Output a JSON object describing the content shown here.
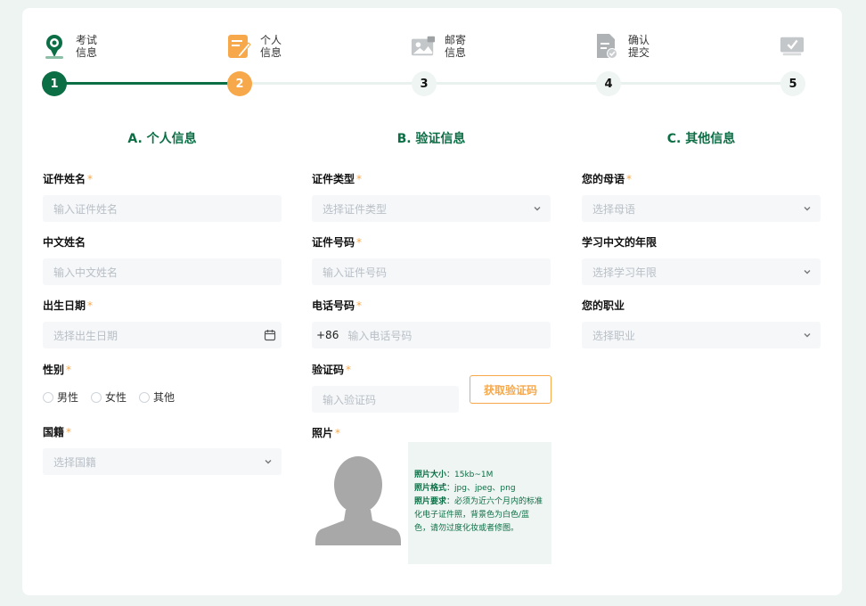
{
  "steps": [
    {
      "label1": "考试",
      "label2": "信息",
      "number": "1",
      "state": "done",
      "icon": "location-pin-icon"
    },
    {
      "label1": "个人",
      "label2": "信息",
      "number": "2",
      "state": "active",
      "icon": "edit-note-icon"
    },
    {
      "label1": "邮寄",
      "label2": "信息",
      "number": "3",
      "state": "todo",
      "icon": "image-card-icon"
    },
    {
      "label1": "确认",
      "label2": "提交",
      "number": "4",
      "state": "todo",
      "icon": "document-check-icon"
    },
    {
      "label1": "",
      "label2": "",
      "number": "5",
      "state": "todo",
      "icon": "monitor-check-icon"
    }
  ],
  "colors": {
    "primary": "#0b6e45",
    "accent": "#f7a84a"
  },
  "personal": {
    "title": "A. 个人信息",
    "name_label": "证件姓名",
    "name_placeholder": "输入证件姓名",
    "cn_name_label": "中文姓名",
    "cn_name_placeholder": "输入中文姓名",
    "dob_label": "出生日期",
    "dob_placeholder": "选择出生日期",
    "gender_label": "性别",
    "gender_options": [
      "男性",
      "女性",
      "其他"
    ],
    "nationality_label": "国籍",
    "nationality_placeholder": "选择国籍"
  },
  "verify": {
    "title": "B. 验证信息",
    "id_type_label": "证件类型",
    "id_type_placeholder": "选择证件类型",
    "id_number_label": "证件号码",
    "id_number_placeholder": "输入证件号码",
    "phone_label": "电话号码",
    "phone_prefix": "+86",
    "phone_placeholder": "输入电话号码",
    "code_label": "验证码",
    "code_placeholder": "输入验证码",
    "code_button": "获取验证码",
    "photo_label": "照片",
    "photo_size_label": "照片大小",
    "photo_size_value": "：15kb~1M",
    "photo_format_label": "照片格式",
    "photo_format_value": "：jpg、jpeg、png",
    "photo_req_label": "照片要求",
    "photo_req_value": "：必须为近六个月内的标准化电子证件照，背景色为白色/蓝色，请勿过度化妆或者修图。"
  },
  "other": {
    "title": "C. 其他信息",
    "native_label": "您的母语",
    "native_placeholder": "选择母语",
    "years_label": "学习中文的年限",
    "years_placeholder": "选择学习年限",
    "job_label": "您的职业",
    "job_placeholder": "选择职业"
  },
  "required_mark": "*"
}
